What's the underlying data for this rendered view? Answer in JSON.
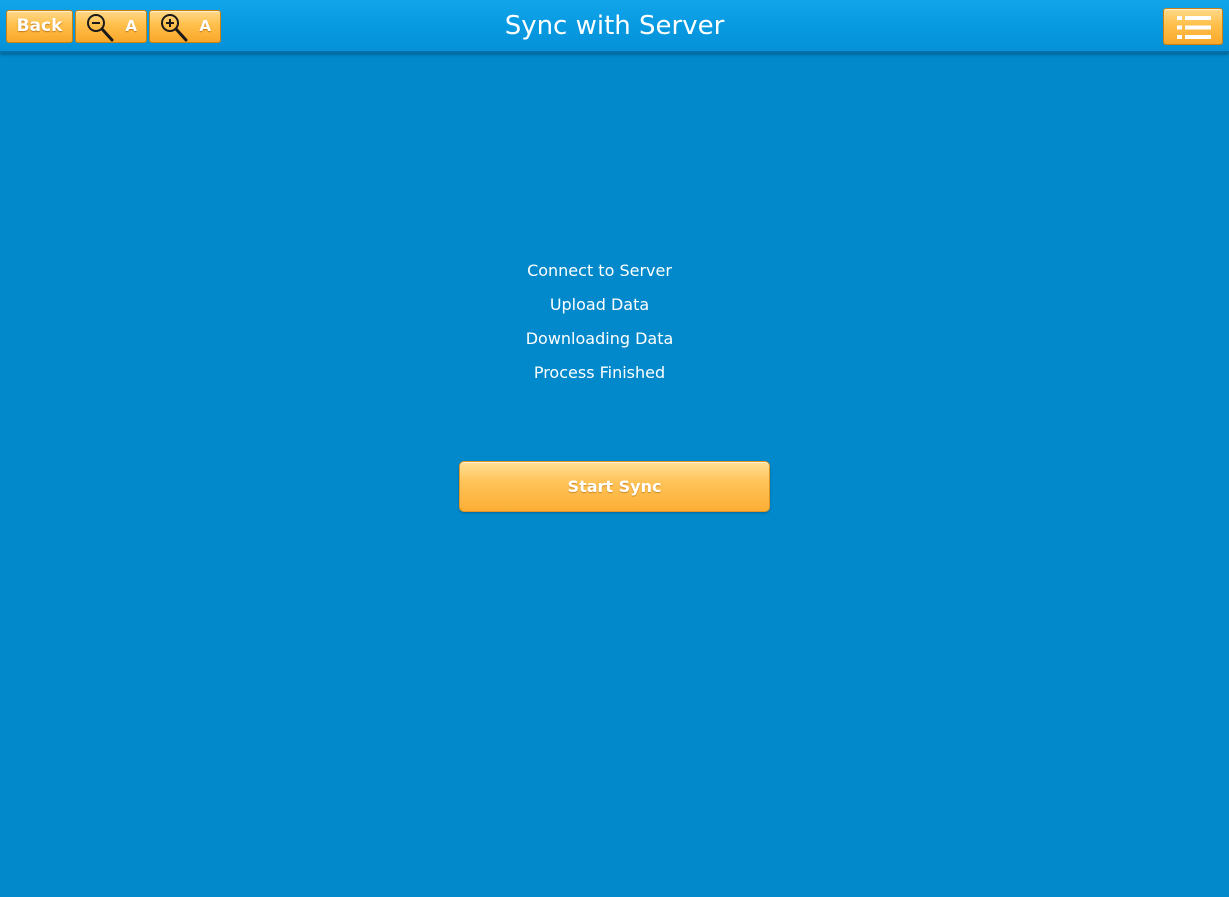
{
  "header": {
    "title": "Sync with Server",
    "back_label": "Back",
    "zoom_out_letter": "A",
    "zoom_in_letter": "A",
    "zoom_out_icon": "zoom-out-icon",
    "zoom_in_icon": "zoom-in-icon",
    "menu_icon": "list-menu-icon"
  },
  "steps": [
    {
      "label": "Connect to Server"
    },
    {
      "label": "Upload Data"
    },
    {
      "label": "Downloading Data"
    },
    {
      "label": "Process Finished"
    }
  ],
  "sync_button": {
    "label": "Start Sync"
  },
  "colors": {
    "background": "#0189cc",
    "header": "#0799e0",
    "button_orange": "#ffbf4a",
    "text": "#ffffff"
  }
}
